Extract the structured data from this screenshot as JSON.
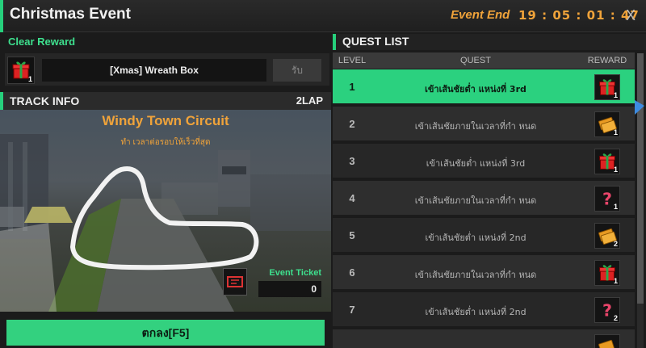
{
  "window": {
    "title": "Christmas Event",
    "event_end_label": "Event End",
    "timer": "19 : 05 : 01 : 47",
    "close_icon": "close-icon",
    "close_glyph": "X"
  },
  "clear_reward": {
    "label": "Clear Reward",
    "item_name": "[Xmas] Wreath Box",
    "item_count": "1",
    "receive_label": "รับ"
  },
  "track_info": {
    "header": "TRACK INFO",
    "laps": "2LAP",
    "track_name": "Windy Town Circuit",
    "subtitle": "ทำ เวลาต่อรอบให้เร็วที่สุด",
    "ticket_label": "Event Ticket",
    "ticket_count": "0"
  },
  "confirm_button": "ตกลง[F5]",
  "quest_list": {
    "header": "QUEST LIST",
    "columns": {
      "level": "LEVEL",
      "quest": "QUEST",
      "reward": "REWARD"
    },
    "rows": [
      {
        "level": "1",
        "quest": "เข้าเส้นชัยต่ำ แหน่งที่ 3rd",
        "reward_icon": "gift-icon",
        "reward_count": "1",
        "active": true
      },
      {
        "level": "2",
        "quest": "เข้าเส้นชัยภายในเวลาที่กำ หนด",
        "reward_icon": "ticket-icon",
        "reward_count": "1",
        "active": false
      },
      {
        "level": "3",
        "quest": "เข้าเส้นชัยต่ำ แหน่งที่ 3rd",
        "reward_icon": "gift-icon",
        "reward_count": "1",
        "active": false
      },
      {
        "level": "4",
        "quest": "เข้าเส้นชัยภายในเวลาที่กำ หนด",
        "reward_icon": "mystery-icon",
        "reward_count": "1",
        "active": false
      },
      {
        "level": "5",
        "quest": "เข้าเส้นชัยต่ำ แหน่งที่ 2nd",
        "reward_icon": "ticket-icon",
        "reward_count": "2",
        "active": false
      },
      {
        "level": "6",
        "quest": "เข้าเส้นชัยภายในเวลาที่กำ หนด",
        "reward_icon": "gift-icon",
        "reward_count": "1",
        "active": false
      },
      {
        "level": "7",
        "quest": "เข้าเส้นชัยต่ำ แหน่งที่ 2nd",
        "reward_icon": "mystery-icon",
        "reward_count": "2",
        "active": false
      },
      {
        "level": "",
        "quest": "",
        "reward_icon": "ticket-icon",
        "reward_count": "",
        "active": false
      }
    ]
  },
  "colors": {
    "accent_green": "#2bd17f",
    "orange": "#f0a33a",
    "panel": "#2e2e2e"
  }
}
